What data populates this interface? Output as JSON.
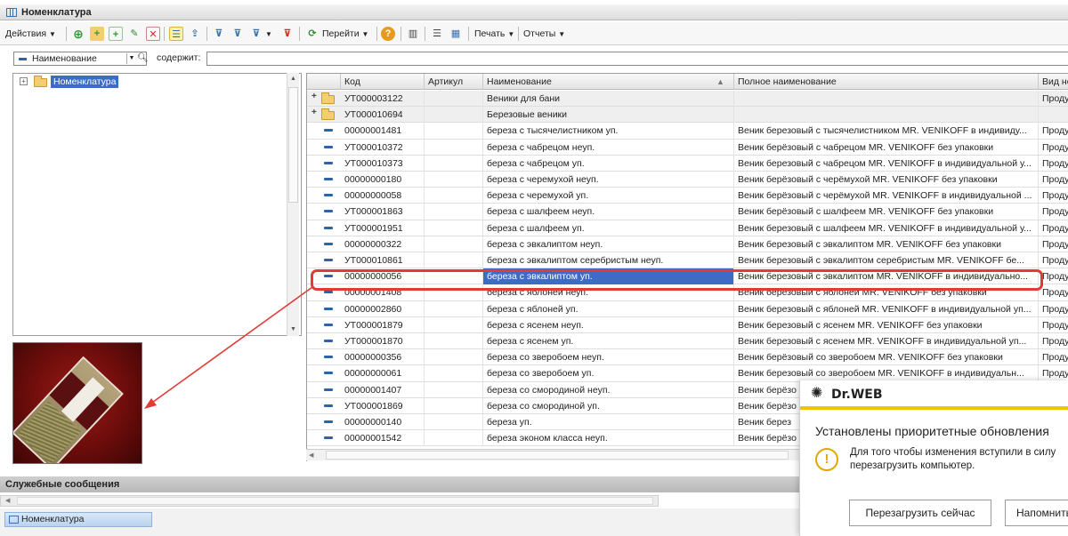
{
  "window": {
    "title": "Номенклатура"
  },
  "toolbar": {
    "actions_label": "Действия",
    "goto_label": "Перейти",
    "print_label": "Печать",
    "reports_label": "Отчеты"
  },
  "filter": {
    "field": "Наименование",
    "contains_label": "содержит:",
    "value": ""
  },
  "tree": {
    "root_label": "Номенклатура"
  },
  "grid": {
    "columns": [
      "Код",
      "Артикул",
      "Наименование",
      "Полное наименование",
      "Вид но"
    ],
    "rows": [
      {
        "type": "folder",
        "code": "УТ000003122",
        "article": "",
        "name": "Веники для бани",
        "full_name": "",
        "kind": "Продук"
      },
      {
        "type": "folder",
        "code": "УТ000010694",
        "article": "",
        "name": "Березовые веники",
        "full_name": "",
        "kind": ""
      },
      {
        "type": "item",
        "code": "00000001481",
        "article": "",
        "name": "береза с тысячелистником уп.",
        "full_name": "Веник березовый с тысячелистником MR. VENIKOFF в индивиду...",
        "kind": "Продук"
      },
      {
        "type": "item",
        "code": "УТ000010372",
        "article": "",
        "name": "береза с чабрецом неуп.",
        "full_name": "Веник берёзовый с чабрецом MR. VENIKOFF без упаковки",
        "kind": "Продук"
      },
      {
        "type": "item",
        "code": "УТ000010373",
        "article": "",
        "name": "береза с чабрецом уп.",
        "full_name": "Веник березовый с чабрецом MR. VENIKOFF в индивидуальной у...",
        "kind": "Продук"
      },
      {
        "type": "item",
        "code": "00000000180",
        "article": "",
        "name": "береза с черемухой неуп.",
        "full_name": "Веник берёзовый с черёмухой MR. VENIKOFF без упаковки",
        "kind": "Продук"
      },
      {
        "type": "item",
        "code": "00000000058",
        "article": "",
        "name": "береза с черемухой уп.",
        "full_name": "Веник берёзовый с черёмухой MR. VENIKOFF в индивидуальной ...",
        "kind": "Продук"
      },
      {
        "type": "item",
        "code": "УТ000001863",
        "article": "",
        "name": "береза с шалфеем неуп.",
        "full_name": "Веник берёзовый с шалфеем MR. VENIKOFF без упаковки",
        "kind": "Продук"
      },
      {
        "type": "item",
        "code": "УТ000001951",
        "article": "",
        "name": "береза с шалфеем уп.",
        "full_name": "Веник березовый с шалфеем MR. VENIKOFF в индивидуальной у...",
        "kind": "Продук"
      },
      {
        "type": "item",
        "code": "00000000322",
        "article": "",
        "name": "береза с эвкалиптом неуп.",
        "full_name": "Веник березовый с эвкалиптом MR. VENIKOFF без упаковки",
        "kind": "Продук"
      },
      {
        "type": "item",
        "code": "УТ000010861",
        "article": "",
        "name": "береза с эвкалиптом серебристым неуп.",
        "full_name": "Веник березовый с эвкалиптом серебристым MR. VENIKOFF бе...",
        "kind": "Продук"
      },
      {
        "type": "item",
        "code": "00000000056",
        "article": "",
        "name": "береза с эвкалиптом уп.",
        "full_name": "Веник березовый с эвкалиптом MR. VENIKOFF в индивидуально...",
        "kind": "Продук",
        "selected": true
      },
      {
        "type": "item",
        "code": "00000001408",
        "article": "",
        "name": "береза с яблоней неуп.",
        "full_name": "Веник березовый с яблоней MR. VENIKOFF без упаковки",
        "kind": "Продук"
      },
      {
        "type": "item",
        "code": "00000002860",
        "article": "",
        "name": "береза с яблоней уп.",
        "full_name": "Веник березовый с яблоней MR. VENIKOFF в индивидуальной уп...",
        "kind": "Продук"
      },
      {
        "type": "item",
        "code": "УТ000001879",
        "article": "",
        "name": "береза с ясенем неуп.",
        "full_name": "Веник березовый с ясенем MR. VENIKOFF без упаковки",
        "kind": "Продук"
      },
      {
        "type": "item",
        "code": "УТ000001870",
        "article": "",
        "name": "береза с ясенем уп.",
        "full_name": "Веник березовый с ясенем MR. VENIKOFF в индивидуальной уп...",
        "kind": "Продук"
      },
      {
        "type": "item",
        "code": "00000000356",
        "article": "",
        "name": "береза со зверобоем неуп.",
        "full_name": "Веник берёзовый со зверобоем MR. VENIKOFF без упаковки",
        "kind": "Продук"
      },
      {
        "type": "item",
        "code": "00000000061",
        "article": "",
        "name": "береза со зверобоем уп.",
        "full_name": "Веник березовый со зверобоем MR. VENIKOFF в индивидуальн...",
        "kind": "Продук"
      },
      {
        "type": "item",
        "code": "00000001407",
        "article": "",
        "name": "береза со смородиной неуп.",
        "full_name": "Веник берёзо",
        "kind": ""
      },
      {
        "type": "item",
        "code": "УТ000001869",
        "article": "",
        "name": "береза со смородиной уп.",
        "full_name": "Веник берёзо",
        "kind": ""
      },
      {
        "type": "item",
        "code": "00000000140",
        "article": "",
        "name": "береза уп.",
        "full_name": "Веник берез",
        "kind": ""
      },
      {
        "type": "item",
        "code": "00000001542",
        "article": "",
        "name": "береза эконом класса неуп.",
        "full_name": "Веник берёзо",
        "kind": ""
      }
    ]
  },
  "service_messages": {
    "label": "Служебные сообщения"
  },
  "taskbar": {
    "item_label": "Номенклатура"
  },
  "notification": {
    "brand": "Dr.WEB",
    "title": "Установлены приоритетные обновления",
    "message_line1": "Для того чтобы изменения вступили в силу",
    "message_line2": "перезагрузить компьютер.",
    "restart_button": "Перезагрузить сейчас",
    "remind_button": "Напомнить"
  },
  "colors": {
    "selection": "#3d6cc4",
    "highlight_annotation": "#e03b36",
    "drweb_accent": "#f4c300"
  }
}
